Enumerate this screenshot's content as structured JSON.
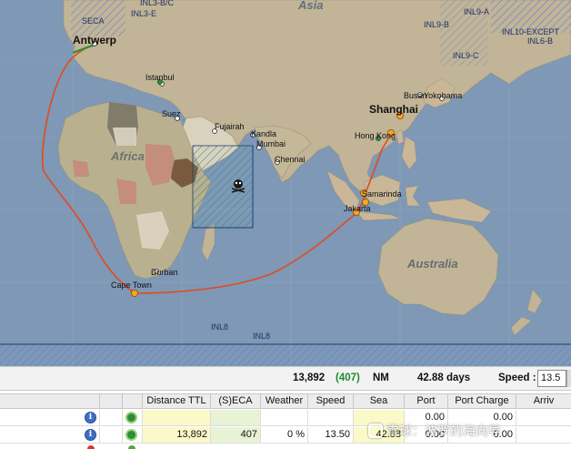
{
  "map": {
    "labels": {
      "asia": "Asia",
      "africa": "Africa",
      "australia": "Australia",
      "seca": "SECA",
      "inl3be": "INL3-E",
      "inl3bc": "INL3-B/C",
      "inl9a": "INL9-A",
      "inl9b": "INL9-B",
      "inl9c": "INL9-C",
      "inl10": "INL10-EXCEPT",
      "inl6b": "INL6-B",
      "inl8a": "INL8",
      "inl8b": "INL8"
    },
    "ports": {
      "antwerp": "Antwerp",
      "istanbul": "Istanbul",
      "suez": "Suez",
      "fujairah": "Fujairah",
      "kandla": "Kandla",
      "mumbai": "Mumbai",
      "chennai": "Chennai",
      "busan": "Busan",
      "yokohama": "Yokohama",
      "shanghai": "Shanghai",
      "hongkong": "Hong Kong",
      "samarinda": "Samarinda",
      "jakarta": "Jakarta",
      "durban": "Durban",
      "capetown": "Cape Town"
    },
    "colors": {
      "ocean": "#7e98b5",
      "land": "#c1b497",
      "route": "#e24a1f",
      "waypoint": "#f5a623",
      "eca_hatch": "#5b7ad8"
    }
  },
  "summary": {
    "distance": "13,892",
    "eca": "(407)",
    "unit": "NM",
    "days": "42.88 days",
    "speed_label": "Speed :",
    "speed_value": "13.5"
  },
  "table": {
    "columns": [
      "Distance TTL",
      "(S)ECA",
      "Weather",
      "Speed",
      "Sea",
      "Port",
      "Port Charge",
      "Arriv"
    ],
    "rows": [
      {
        "distance": "",
        "eca": "",
        "weather": "",
        "speed": "",
        "sea": "",
        "port": "0.00",
        "port_charge": "0.00"
      },
      {
        "distance": "13,892",
        "eca": "407",
        "weather": "0 %",
        "speed": "13.50",
        "sea": "42.88",
        "port": "0.00",
        "port_charge": "0.00"
      }
    ]
  },
  "watermark": "雪球：波罗的海向导"
}
